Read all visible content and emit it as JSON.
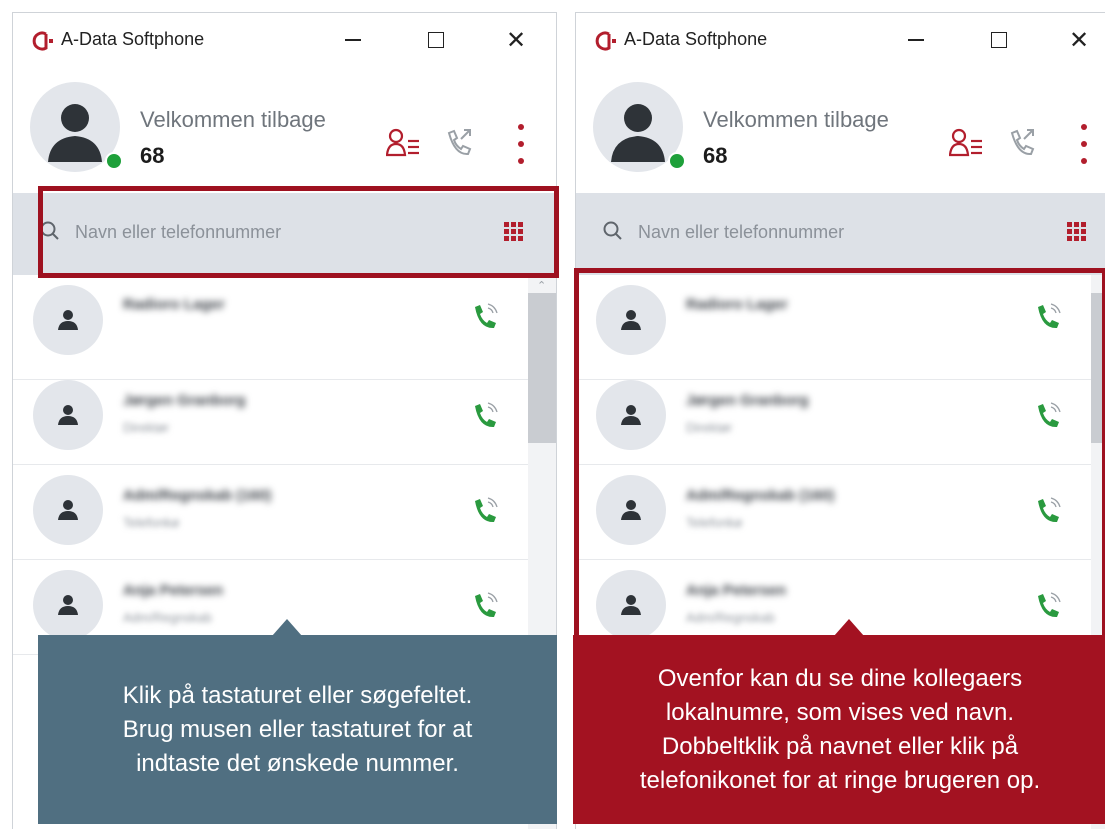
{
  "app": {
    "title": "A-Data Softphone",
    "brand_color": "#b21e2d"
  },
  "window_controls": [
    "minimize-icon",
    "maximize-icon",
    "close-icon"
  ],
  "header": {
    "welcome": "Velkommen tilbage",
    "extension": "68",
    "status_color": "#1ea03a",
    "icons": [
      "contacts-icon",
      "call-history-icon",
      "more-menu-icon"
    ]
  },
  "search": {
    "placeholder": "Navn eller telefonnummer",
    "icons": [
      "search-icon",
      "keypad-icon"
    ]
  },
  "contacts": [
    {
      "name": "Radioro Lager",
      "role": ""
    },
    {
      "name": "Jørgen Granborg",
      "role": "Direktør"
    },
    {
      "name": "Adm/Regnskab (160)",
      "role": "Telefonkø"
    },
    {
      "name": "Anja Petersen",
      "role": "Adm/Regnskab"
    }
  ],
  "callouts": {
    "left": {
      "text": "Klik på tastaturet eller søgefeltet.\nBrug musen eller tastaturet for at\nindtaste det ønskede nummer.",
      "color": "#506f81"
    },
    "right": {
      "text": "Ovenfor kan du se dine kollegaers\nlokalnumre, som vises ved navn.\nDobbeltklik på navnet eller klik på\ntelefonikonet for at ringe brugeren op.",
      "color": "#a31221"
    }
  },
  "highlight_color": "#9e1120"
}
